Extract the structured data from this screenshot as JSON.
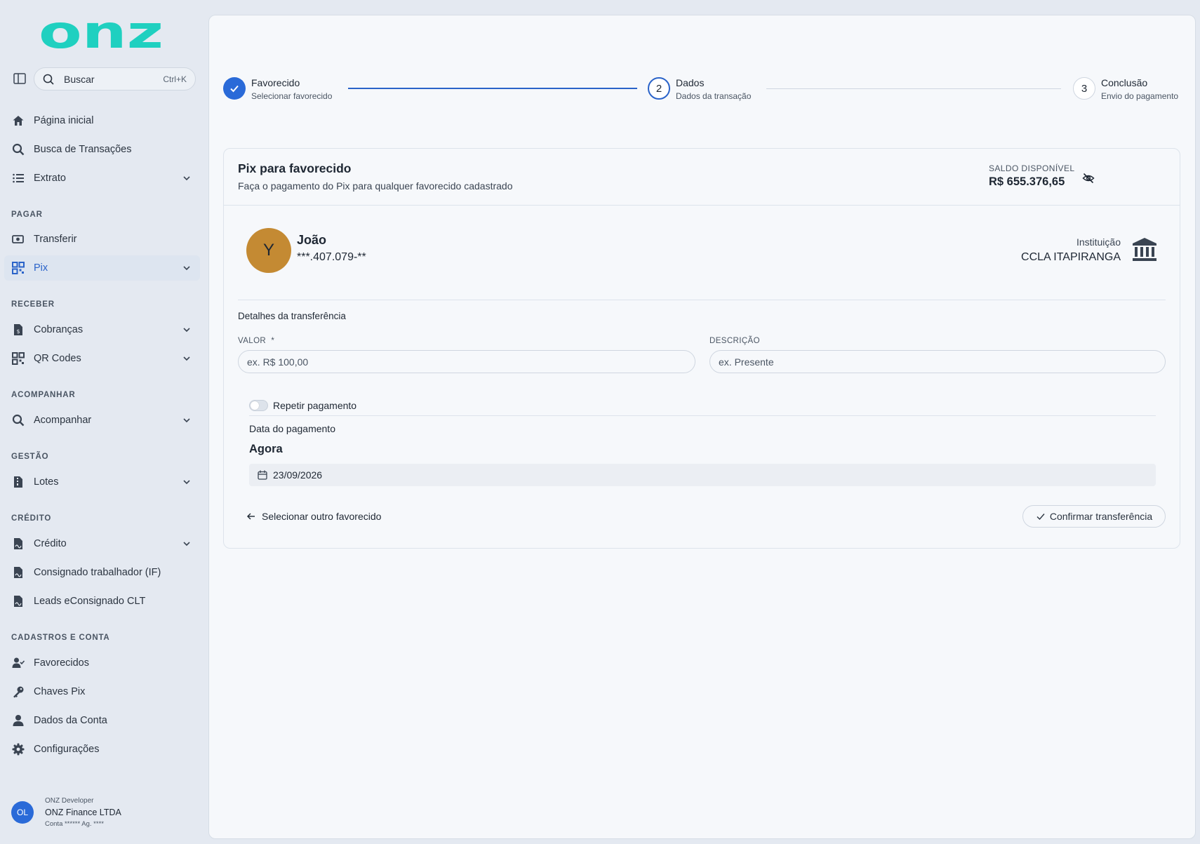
{
  "brand": {
    "logo_text": "onz",
    "color": "#1fd0c0"
  },
  "search": {
    "label": "Buscar",
    "shortcut": "Ctrl+K"
  },
  "nav": {
    "home": "Página inicial",
    "transactions": "Busca de Transações",
    "statement": "Extrato",
    "section_pay": "PAGAR",
    "transfer": "Transferir",
    "pix": "Pix",
    "section_receive": "RECEBER",
    "charges": "Cobranças",
    "qrcodes": "QR Codes",
    "section_track": "ACOMPANHAR",
    "track": "Acompanhar",
    "section_management": "GESTÃO",
    "batches": "Lotes",
    "section_credit": "CRÉDITO",
    "credit": "Crédito",
    "payroll": "Consignado trabalhador (IF)",
    "leads": "Leads eConsignado CLT",
    "section_registry": "CADASTROS E CONTA",
    "favorites": "Favorecidos",
    "pix_keys": "Chaves Pix",
    "account_data": "Dados da Conta",
    "settings": "Configurações"
  },
  "user": {
    "initials": "OL",
    "role": "ONZ Developer",
    "company": "ONZ Finance LTDA",
    "account": "Conta ****** Ag. ****"
  },
  "stepper": [
    {
      "title": "Favorecido",
      "subtitle": "Selecionar favorecido",
      "state": "done"
    },
    {
      "number": "2",
      "title": "Dados",
      "subtitle": "Dados da transação",
      "state": "active"
    },
    {
      "number": "3",
      "title": "Conclusão",
      "subtitle": "Envio do pagamento",
      "state": "todo"
    }
  ],
  "card": {
    "title": "Pix para favorecido",
    "subtitle": "Faça o pagamento do Pix para qualquer favorecido cadastrado",
    "balance_label": "SALDO DISPONÍVEL",
    "balance_value": "R$ 655.376,65"
  },
  "favorite": {
    "initial": "Y",
    "name": "João",
    "document": "***.407.079-**",
    "institution_label": "Instituição",
    "institution_value": "CCLA ITAPIRANGA"
  },
  "details": {
    "title": "Detalhes da transferência",
    "value_label": "VALOR",
    "required_mark": "*",
    "value_placeholder": "ex. R$ 100,00",
    "description_label": "DESCRIÇÃO",
    "description_placeholder": "ex. Presente",
    "repeat_label": "Repetir pagamento",
    "payment_date_label": "Data do pagamento",
    "payment_now": "Agora",
    "date_value": "23/09/2026"
  },
  "actions": {
    "back": "Selecionar outro favorecido",
    "confirm": "Confirmar transferência"
  },
  "colors": {
    "primary": "#2a6ad8",
    "sidebar_bg": "#e4e9f1",
    "avatar_bg": "#c48a33"
  }
}
